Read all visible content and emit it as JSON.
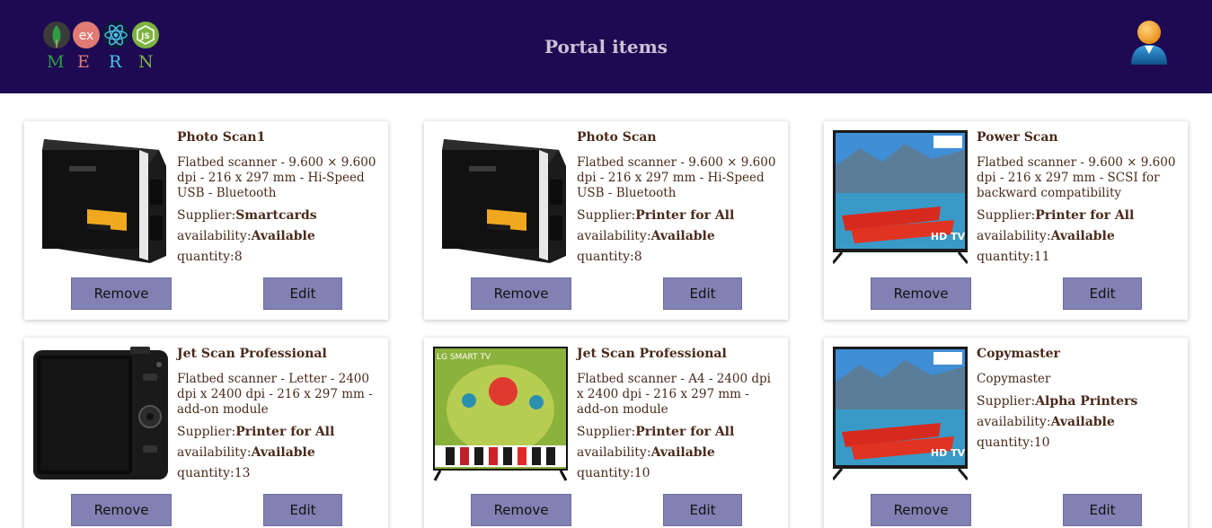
{
  "header": {
    "title": "Portal items",
    "logo_letters": [
      "M",
      "E",
      "R",
      "N"
    ],
    "logo_badge_text": [
      "ex",
      "JS"
    ],
    "background": "#1d0a52"
  },
  "cards": [
    {
      "name": "Photo Scan1",
      "description": "Flatbed scanner - 9.600 × 9.600 dpi - 216 x 297 mm - Hi-Speed USB - Bluetooth",
      "supplier_label": "Supplier:",
      "supplier": "Smartcards",
      "availability_label": "availability:",
      "availability": "Available",
      "quantity_label": "quantity:",
      "quantity": "8",
      "image": "scanner",
      "remove_label": "Remove",
      "edit_label": "Edit"
    },
    {
      "name": "Photo Scan",
      "description": "Flatbed scanner - 9.600 × 9.600 dpi - 216 x 297 mm - Hi-Speed USB - Bluetooth",
      "supplier_label": "Supplier:",
      "supplier": "Printer for All",
      "availability_label": "availability:",
      "availability": "Available",
      "quantity_label": "quantity:",
      "quantity": "8",
      "image": "scanner",
      "remove_label": "Remove",
      "edit_label": "Edit"
    },
    {
      "name": "Power Scan",
      "description": "Flatbed scanner - 9.600 × 9.600 dpi - 216 x 297 mm - SCSI for backward compatibility",
      "supplier_label": "Supplier:",
      "supplier": "Printer for All",
      "availability_label": "availability:",
      "availability": "Available",
      "quantity_label": "quantity:",
      "quantity": "11",
      "image": "tv-boats",
      "image_badge": "HD TV",
      "remove_label": "Remove",
      "edit_label": "Edit"
    },
    {
      "name": "Jet Scan Professional",
      "description": "Flatbed scanner - Letter - 2400 dpi x 2400 dpi - 216 x 297 mm - add-on module",
      "supplier_label": "Supplier:",
      "supplier": "Printer for All",
      "availability_label": "availability:",
      "availability": "Available",
      "quantity_label": "quantity:",
      "quantity": "13",
      "image": "camera",
      "remove_label": "Remove",
      "edit_label": "Edit"
    },
    {
      "name": "Jet Scan Professional",
      "description": "Flatbed scanner - A4 - 2400 dpi x 2400 dpi - 216 x 297 mm - add-on module",
      "supplier_label": "Supplier:",
      "supplier": "Printer for All",
      "availability_label": "availability:",
      "availability": "Available",
      "quantity_label": "quantity:",
      "quantity": "10",
      "image": "tv-birds",
      "image_badge": "LG SMART TV",
      "remove_label": "Remove",
      "edit_label": "Edit"
    },
    {
      "name": "Copymaster",
      "description": "Copymaster",
      "supplier_label": "Supplier:",
      "supplier": "Alpha Printers",
      "availability_label": "availability:",
      "availability": "Available",
      "quantity_label": "quantity:",
      "quantity": "10",
      "image": "tv-boats",
      "image_badge": "HD TV",
      "remove_label": "Remove",
      "edit_label": "Edit"
    }
  ],
  "colors": {
    "button": "#8181b3",
    "text": "#4a2a1a",
    "title": "#c9c1d6"
  }
}
